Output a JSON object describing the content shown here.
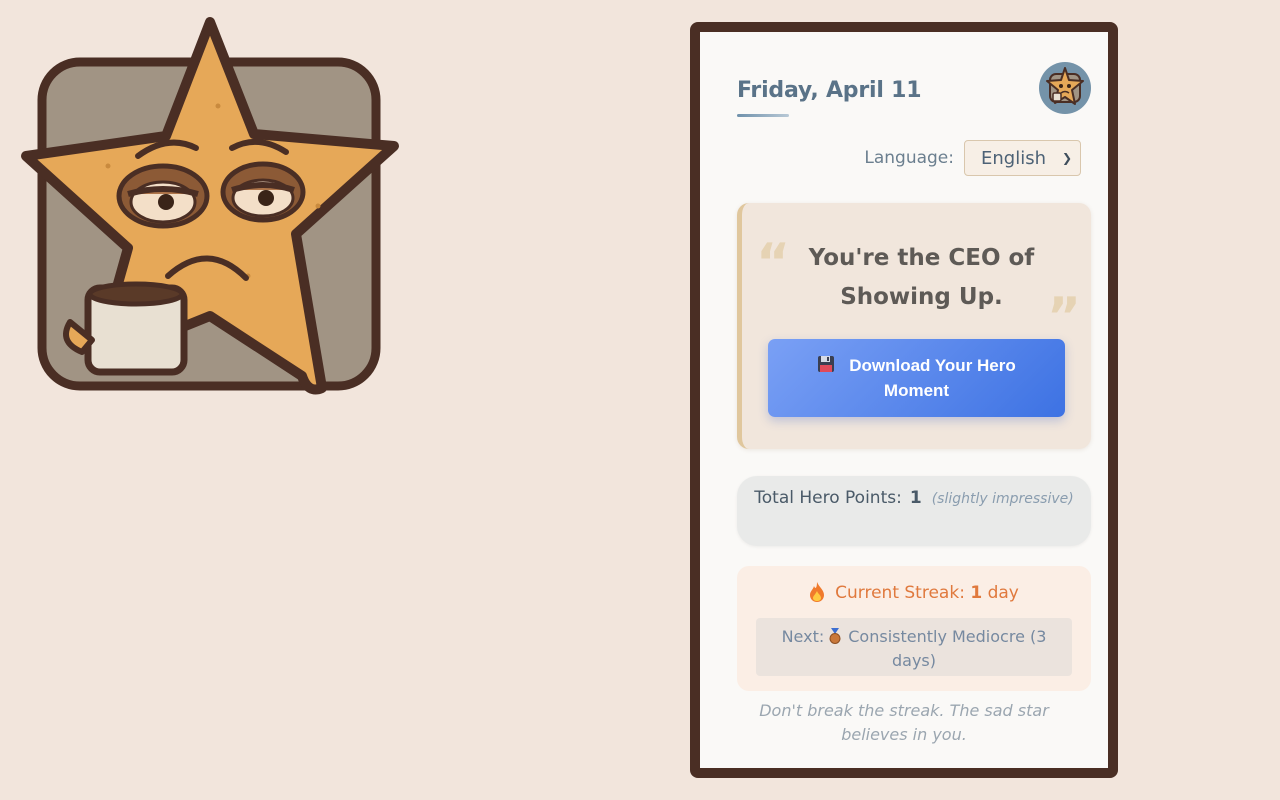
{
  "mascot": {
    "icon": "sad-star-with-coffee-mug",
    "colors": {
      "star": "#e6a858",
      "frame": "#a19484",
      "outline": "#4a2e24"
    }
  },
  "header": {
    "date": "Friday, April 11",
    "avatar_icon": "sad-star-avatar"
  },
  "language": {
    "label": "Language:",
    "selected": "English"
  },
  "quote": {
    "text": "You're the CEO of Showing Up.",
    "open_mark": "“",
    "close_mark": "”",
    "download_label": "Download Your Hero Moment",
    "download_icon": "floppy-disk-icon"
  },
  "points": {
    "label": "Total Hero Points:",
    "value": "1",
    "note": "(slightly impressive)"
  },
  "streak": {
    "label": "Current Streak:",
    "value": "1",
    "unit": "day",
    "icon": "flame-icon",
    "next_prefix": "Next:",
    "next_icon": "bronze-medal-icon",
    "next_text": "Consistently Mediocre (3 days)"
  },
  "footer": {
    "note": "Don't break the streak. The sad star believes in you."
  },
  "colors": {
    "background": "#f2e5dc",
    "accent_blue": "#3d72e3",
    "streak_orange": "#e0793d",
    "frame_brown": "#4a2e24"
  }
}
